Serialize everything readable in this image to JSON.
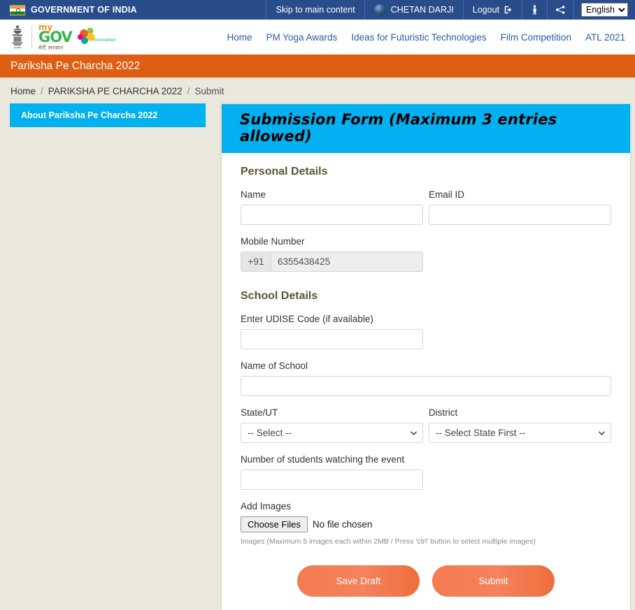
{
  "gov_bar": {
    "title": "GOVERNMENT OF INDIA",
    "skip_link": "Skip to main content",
    "user_name": "CHETAN DARJI",
    "logout": "Logout",
    "accessibility_icon": "accessibility-icon",
    "sitemap_icon": "sitemap-icon",
    "language": "English",
    "language_options": [
      "English"
    ]
  },
  "brand": {
    "emblem_alt": "national-emblem",
    "logo_top": "my",
    "logo_main": "GOV",
    "logo_sub": "मेरी सरकार",
    "logo_tag": "innovation"
  },
  "nav": {
    "items": [
      {
        "label": "Home"
      },
      {
        "label": "PM Yoga Awards"
      },
      {
        "label": "Ideas for Futuristic Technologies"
      },
      {
        "label": "Film Competition"
      },
      {
        "label": "ATL 2021"
      }
    ]
  },
  "page_band": {
    "title": "Pariksha Pe Charcha 2022"
  },
  "breadcrumb": {
    "items": [
      "Home",
      "PARIKSHA PE CHARCHA 2022",
      "Submit"
    ],
    "separator": "/"
  },
  "sidebar": {
    "items": [
      {
        "label": "About Pariksha Pe Charcha 2022"
      }
    ]
  },
  "form": {
    "header": "Submission Form (Maximum 3 entries allowed)",
    "sections": {
      "personal": "Personal Details",
      "school": "School Details"
    },
    "fields": {
      "name": {
        "label": "Name",
        "value": "",
        "placeholder": ""
      },
      "email": {
        "label": "Email ID",
        "value": "",
        "placeholder": ""
      },
      "mobile": {
        "label": "Mobile Number",
        "prefix": "+91",
        "value": "6355438425"
      },
      "udise": {
        "label": "Enter UDISE Code (if available)",
        "value": "",
        "placeholder": ""
      },
      "school_name": {
        "label": "Name of School",
        "value": "",
        "placeholder": ""
      },
      "state": {
        "label": "State/UT",
        "selected": "-- Select --",
        "options": [
          "-- Select --"
        ]
      },
      "district": {
        "label": "District",
        "selected": "-- Select State First --",
        "options": [
          "-- Select State First --"
        ]
      },
      "students": {
        "label": "Number of students watching the event",
        "value": "",
        "placeholder": ""
      },
      "images": {
        "label": "Add Images",
        "button": "Choose Files",
        "status": "No file chosen",
        "help": "Images (Maximum 5 images each within 2MB / Press 'ctrl' button to select multiple images)"
      }
    },
    "buttons": {
      "save_draft": "Save Draft",
      "submit": "Submit"
    }
  },
  "colors": {
    "gov_bar": "#294c8a",
    "page_band": "#de5e14",
    "cyan": "#03b0f0",
    "button_orange": "#f4795a",
    "page_bg": "#eae7dc",
    "link_blue": "#2b5ca8"
  }
}
